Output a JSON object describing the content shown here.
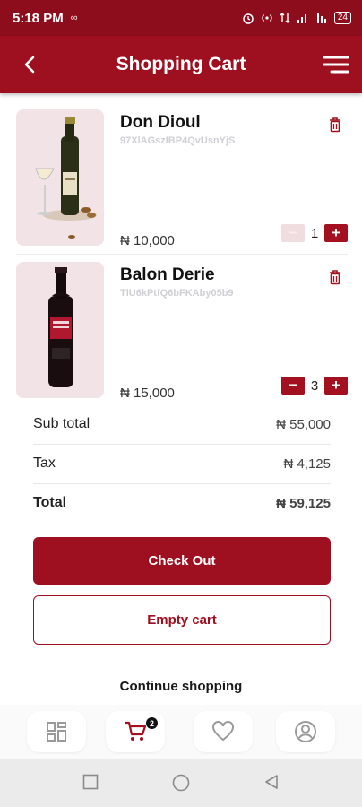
{
  "status_bar": {
    "time": "5:18 PM",
    "indicator": "∞",
    "icons": [
      "alarm-icon",
      "hotspot-icon",
      "data-icon",
      "signal-icon",
      "wifi-icon"
    ],
    "battery": "24"
  },
  "header": {
    "title": "Shopping Cart"
  },
  "cart": {
    "items": [
      {
        "name": "Don Dioul",
        "code": "97XlAGszIBP4QvUsnYjS",
        "price": "₦ 10,000",
        "quantity": "1",
        "minus_enabled": false,
        "image": "white-wine-bottle"
      },
      {
        "name": "Balon Derie",
        "code": "TlU6kPtfQ6bFKAby05b9",
        "price": "₦ 15,000",
        "quantity": "3",
        "minus_enabled": true,
        "image": "red-wine-bottle"
      }
    ]
  },
  "summary": {
    "subtotal_label": "Sub total",
    "subtotal_value": "₦ 55,000",
    "tax_label": "Tax",
    "tax_value": "₦ 4,125",
    "total_label": "Total",
    "total_value": "₦ 59,125"
  },
  "actions": {
    "checkout_label": "Check Out",
    "empty_cart_label": "Empty cart",
    "continue_label": "Continue shopping"
  },
  "bottom_nav": {
    "items": [
      {
        "icon": "grid-icon"
      },
      {
        "icon": "cart-icon",
        "badge": "2"
      },
      {
        "icon": "heart-icon"
      },
      {
        "icon": "profile-icon"
      }
    ]
  },
  "colors": {
    "primary": "#9e0f20",
    "status_bar": "#8e0d1d",
    "thumb_bg": "#f1e3e6"
  }
}
